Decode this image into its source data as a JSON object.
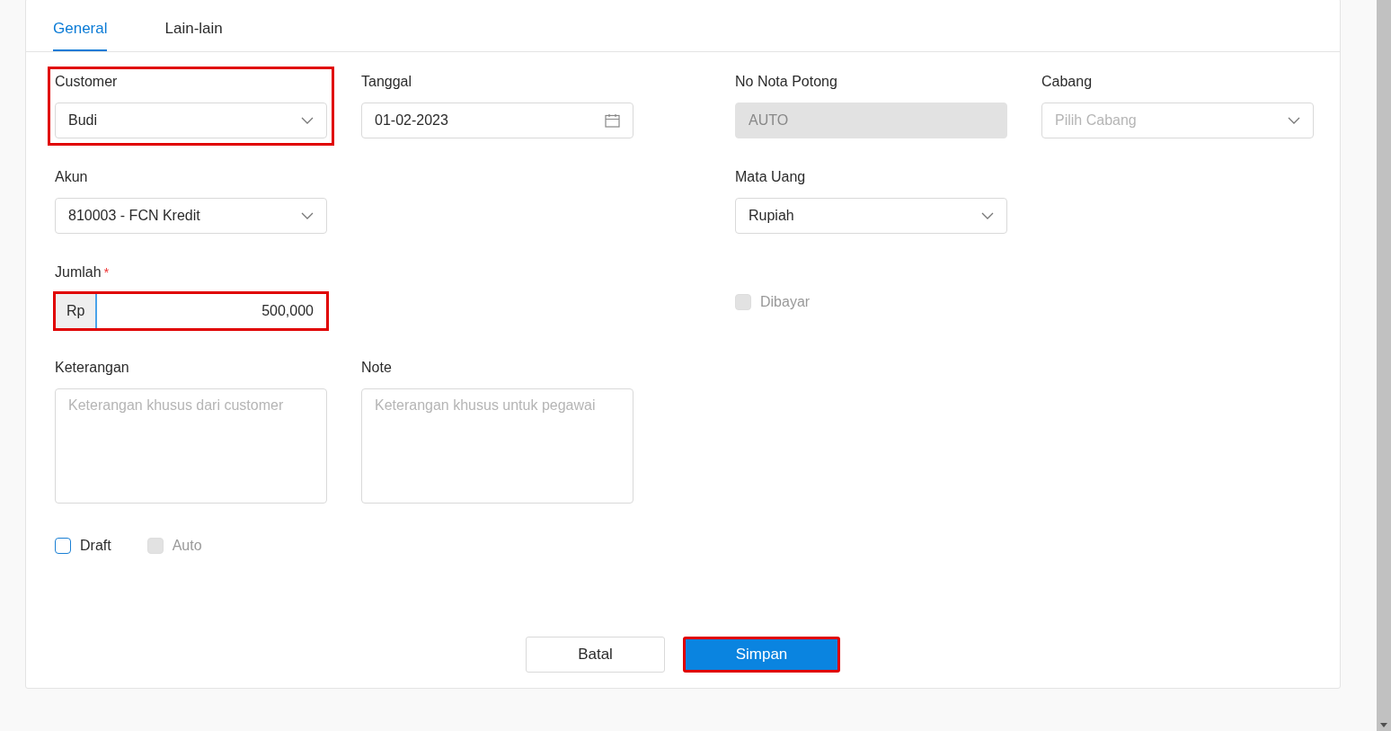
{
  "tabs": [
    {
      "label": "General",
      "selected": true
    },
    {
      "label": "Lain-lain",
      "selected": false
    }
  ],
  "customer": {
    "label": "Customer",
    "value": "Budi",
    "highlighted": true
  },
  "tanggal": {
    "label": "Tanggal",
    "value": "01-02-2023"
  },
  "no_nota_potong": {
    "label": "No Nota Potong",
    "value": "AUTO",
    "disabled": true
  },
  "cabang": {
    "label": "Cabang",
    "placeholder": "Pilih Cabang"
  },
  "akun": {
    "label": "Akun",
    "value": "810003 - FCN Kredit"
  },
  "mata_uang": {
    "label": "Mata Uang",
    "value": "Rupiah"
  },
  "jumlah": {
    "label": "Jumlah",
    "required_mark": "*",
    "prefix": "Rp",
    "value": "500,000",
    "highlighted": true
  },
  "dibayar": {
    "label": "Dibayar",
    "checked": false,
    "disabled": true
  },
  "keterangan": {
    "label": "Keterangan",
    "placeholder": "Keterangan khusus dari customer"
  },
  "note": {
    "label": "Note",
    "placeholder": "Keterangan khusus untuk pegawai"
  },
  "checkboxes": [
    {
      "label": "Draft",
      "checked": false,
      "disabled": false
    },
    {
      "label": "Auto",
      "checked": false,
      "disabled": true
    }
  ],
  "buttons": [
    {
      "label": "Batal",
      "kind": "secondary",
      "highlighted": false
    },
    {
      "label": "Simpan",
      "kind": "primary",
      "highlighted": true
    }
  ]
}
